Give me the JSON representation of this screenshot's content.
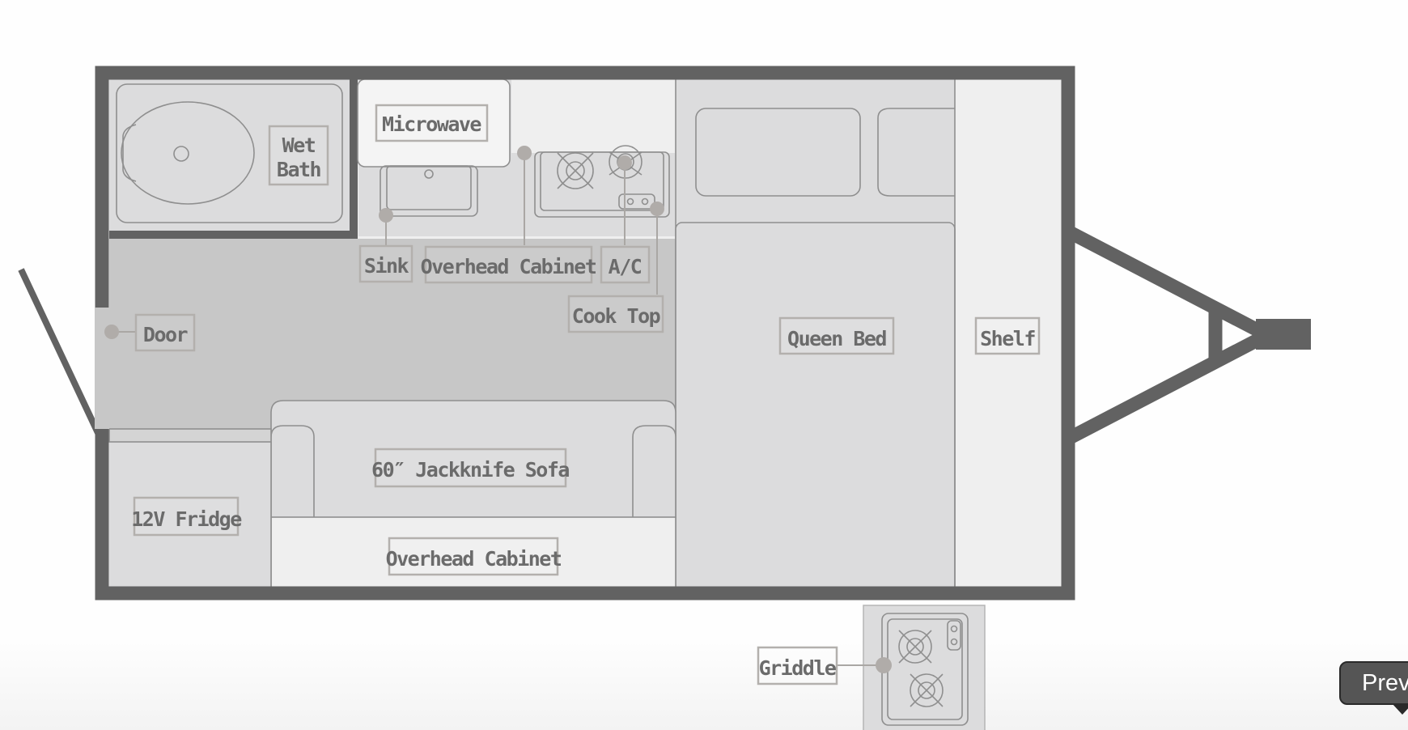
{
  "labels": {
    "wet_bath": [
      "Wet",
      "Bath"
    ],
    "microwave": "Microwave",
    "sink": "Sink",
    "overhead_cabinet_top": "Overhead Cabinet",
    "ac": "A/C",
    "cook_top": "Cook Top",
    "door": "Door",
    "queen_bed": "Queen Bed",
    "shelf": "Shelf",
    "sofa": "60″ Jackknife Sofa",
    "fridge": "12V Fridge",
    "overhead_cabinet_bottom": "Overhead Cabinet",
    "griddle": "Griddle"
  },
  "tooltip": {
    "label": "Prev"
  },
  "colors": {
    "wall": "#626262",
    "floor": "#c7c7c7",
    "furniture": "#dcdcdd",
    "light_surface": "#efefef",
    "label_text": "#6b6b6b",
    "tooltip_bg": "#555555"
  }
}
